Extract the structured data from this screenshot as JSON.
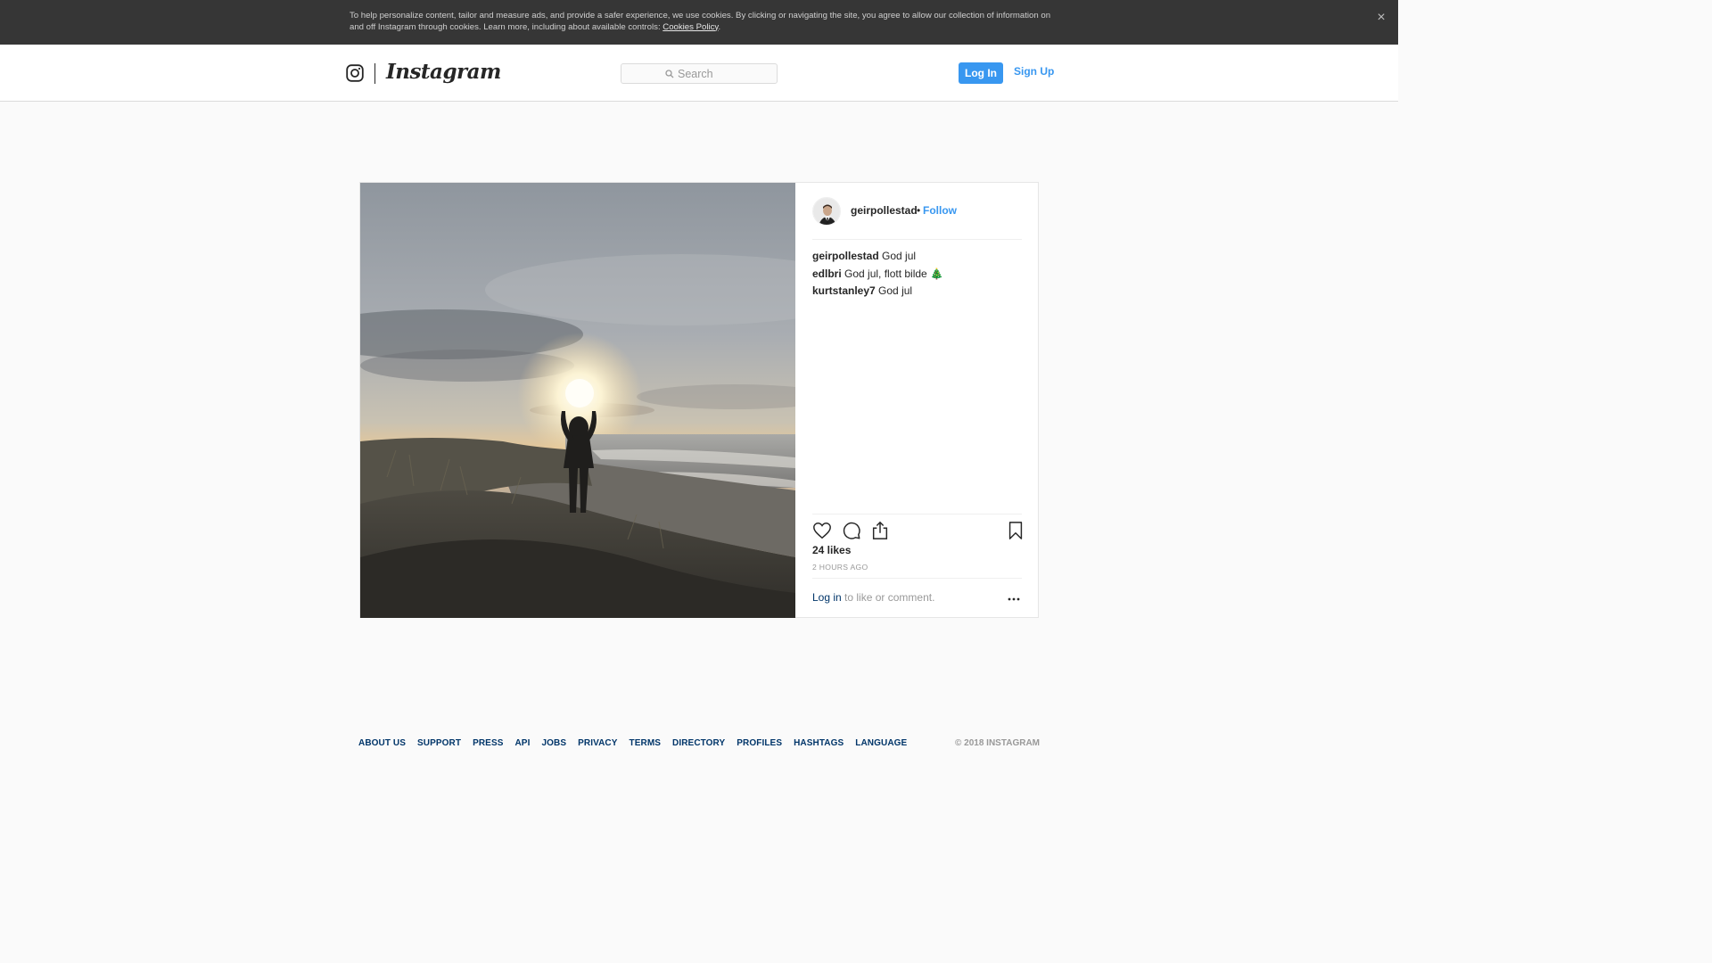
{
  "cookie_banner": {
    "text": "To help personalize content, tailor and measure ads, and provide a safer experience, we use cookies. By clicking or navigating the site, you agree to allow our collection of information on and off Instagram through cookies. Learn more, including about available controls: ",
    "link_text": "Cookies Policy",
    "trailing": ".",
    "close_glyph": "×"
  },
  "header": {
    "wordmark": "Instagram",
    "search_placeholder": "Search",
    "login_label": "Log In",
    "signup_label": "Sign Up"
  },
  "post": {
    "username": "geirpollestad",
    "separator": "•",
    "follow_label": "Follow",
    "comments": [
      {
        "user": "geirpollestad",
        "text": "God jul"
      },
      {
        "user": "edlbri",
        "text": "God jul, flott bilde 🎄"
      },
      {
        "user": "kurtstanley7",
        "text": "God jul"
      }
    ],
    "likes": "24 likes",
    "timestamp": "2 HOURS AGO",
    "login_link": "Log in",
    "login_suffix": " to like or comment."
  },
  "footer": {
    "links": [
      "ABOUT US",
      "SUPPORT",
      "PRESS",
      "API",
      "JOBS",
      "PRIVACY",
      "TERMS",
      "DIRECTORY",
      "PROFILES",
      "HASHTAGS",
      "LANGUAGE"
    ],
    "copyright": "© 2018 INSTAGRAM"
  },
  "colors": {
    "accent": "#3897f0",
    "link_dark": "#003569",
    "banner_bg": "#363636"
  },
  "icons": {
    "close": "close-icon",
    "logo": "instagram-camera-icon",
    "search": "search-icon",
    "like": "heart-icon",
    "comment": "comment-icon",
    "share": "share-icon",
    "save": "bookmark-icon",
    "more": "more-icon"
  }
}
